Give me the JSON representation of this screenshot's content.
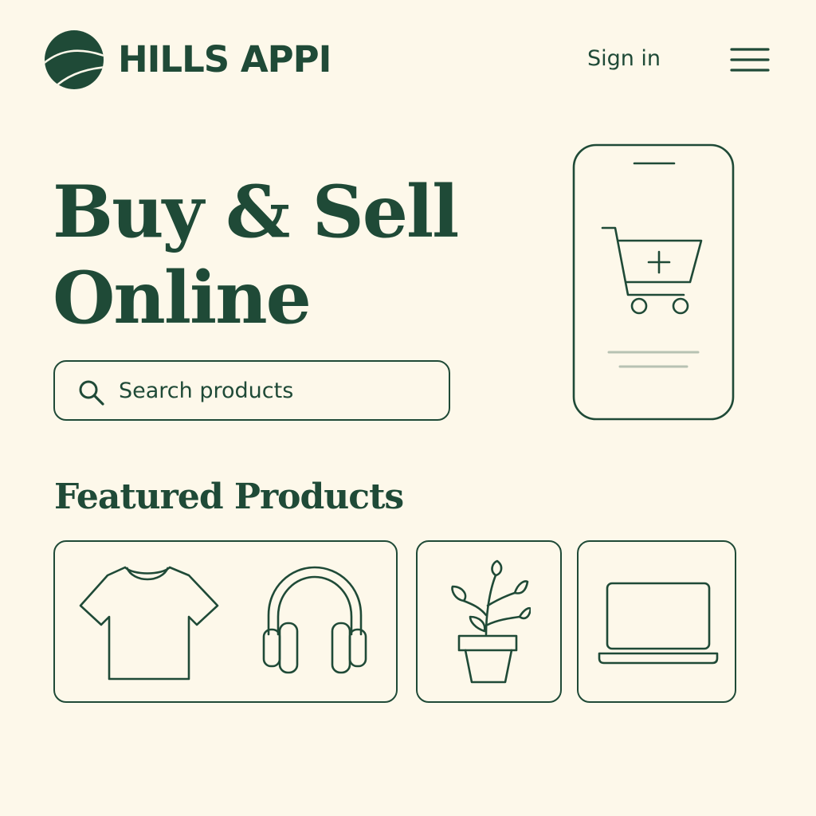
{
  "header": {
    "brand_name": "HILLS APPI",
    "logo_icon": "hills-logo-icon",
    "signin_label": "Sign in",
    "menu_icon": "hamburger-menu-icon"
  },
  "hero": {
    "title_line1": "Buy & Sell",
    "title_line2": "Online",
    "illustration_icon": "phone-shopping-cart-icon"
  },
  "search": {
    "placeholder": "Search products",
    "icon": "search-icon"
  },
  "featured": {
    "title": "Featured Products",
    "cards": [
      {
        "icons": [
          "t-shirt-icon",
          "headphones-icon"
        ]
      },
      {
        "icons": [
          "potted-plant-icon"
        ]
      },
      {
        "icons": [
          "laptop-icon"
        ]
      }
    ]
  },
  "colors": {
    "background": "#fdf8ea",
    "primary": "#1f4a37",
    "muted_line": "#b7c2b3"
  }
}
